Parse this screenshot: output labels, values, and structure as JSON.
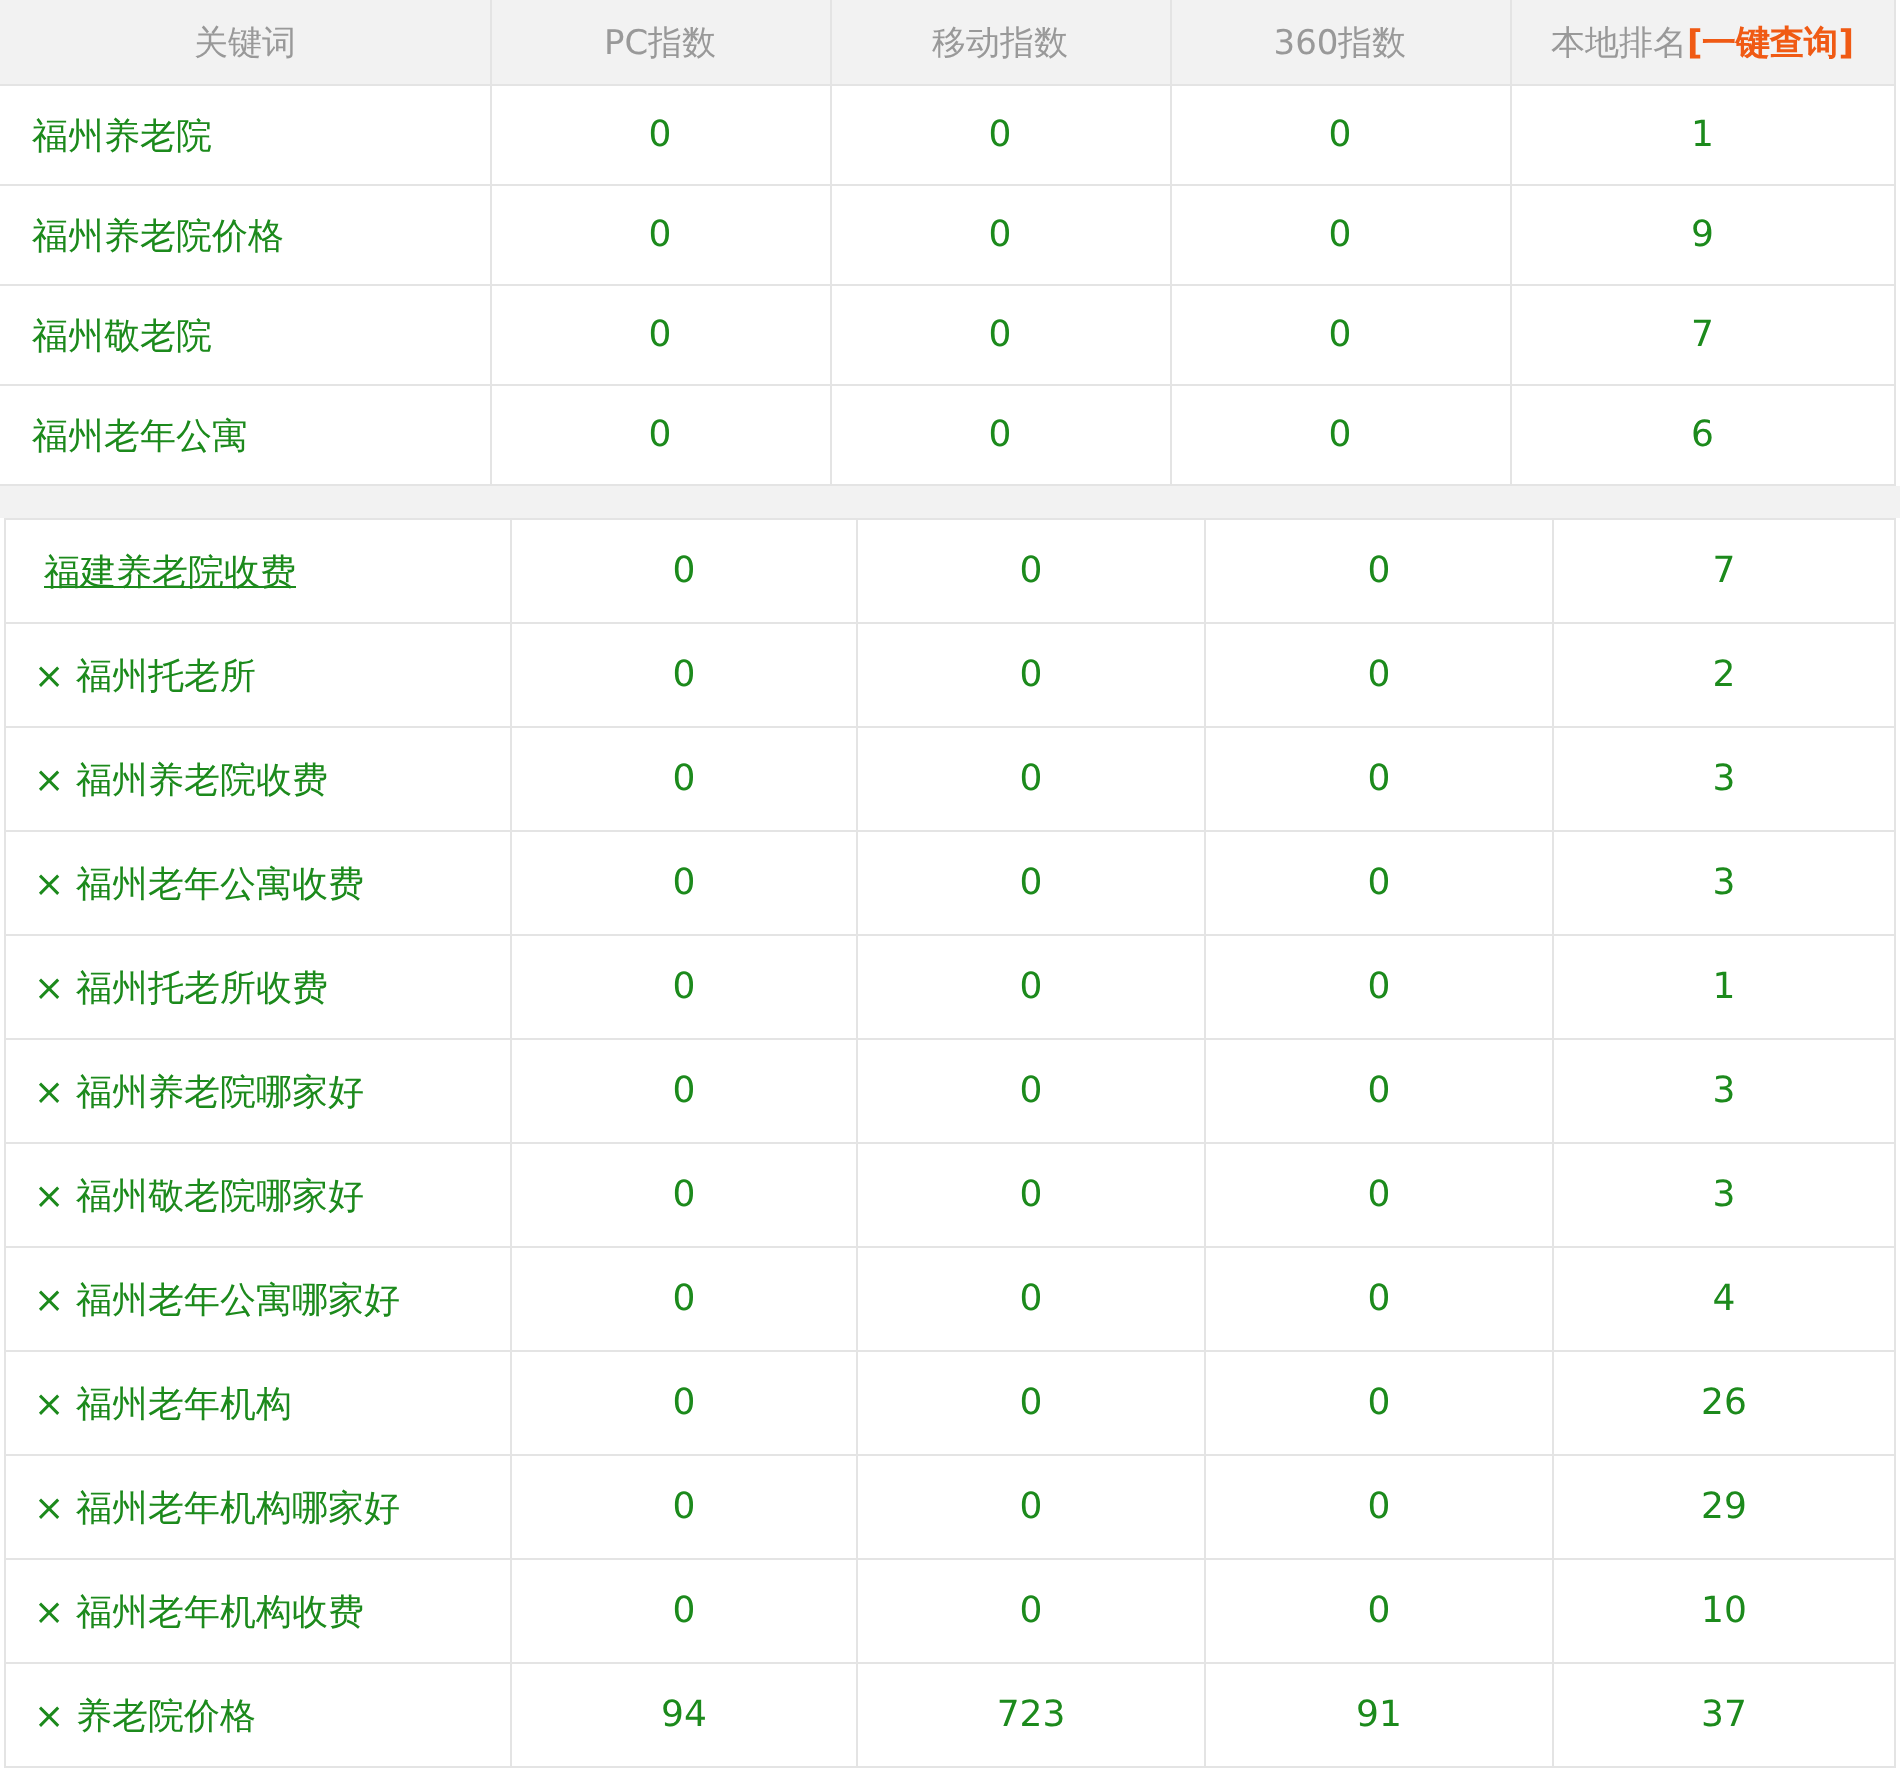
{
  "table": {
    "columns": [
      {
        "label": "关键词"
      },
      {
        "label": "PC指数"
      },
      {
        "label": "移动指数"
      },
      {
        "label": "360指数"
      },
      {
        "label": "本地排名",
        "link": "[一键查询]"
      }
    ],
    "rows": [
      {
        "keyword": "福州养老院",
        "pc": "0",
        "mobile": "0",
        "s360": "0",
        "rank": "1"
      },
      {
        "keyword": "福州养老院价格",
        "pc": "0",
        "mobile": "0",
        "s360": "0",
        "rank": "9"
      },
      {
        "keyword": "福州敬老院",
        "pc": "0",
        "mobile": "0",
        "s360": "0",
        "rank": "7"
      },
      {
        "keyword": "福州老年公寓",
        "pc": "0",
        "mobile": "0",
        "s360": "0",
        "rank": "6"
      }
    ]
  },
  "related_table": {
    "rows": [
      {
        "keyword": "福建养老院收费",
        "underlined": true,
        "pc": "0",
        "mobile": "0",
        "s360": "0",
        "rank": "7"
      },
      {
        "remove": "×",
        "keyword": "福州托老所",
        "underlined": false,
        "pc": "0",
        "mobile": "0",
        "s360": "0",
        "rank": "2"
      },
      {
        "remove": "×",
        "keyword": "福州养老院收费",
        "underlined": false,
        "pc": "0",
        "mobile": "0",
        "s360": "0",
        "rank": "3"
      },
      {
        "remove": "×",
        "keyword": "福州老年公寓收费",
        "underlined": false,
        "pc": "0",
        "mobile": "0",
        "s360": "0",
        "rank": "3"
      },
      {
        "remove": "×",
        "keyword": "福州托老所收费",
        "underlined": false,
        "pc": "0",
        "mobile": "0",
        "s360": "0",
        "rank": "1"
      },
      {
        "remove": "×",
        "keyword": "福州养老院哪家好",
        "underlined": false,
        "pc": "0",
        "mobile": "0",
        "s360": "0",
        "rank": "3"
      },
      {
        "remove": "×",
        "keyword": "福州敬老院哪家好",
        "underlined": false,
        "pc": "0",
        "mobile": "0",
        "s360": "0",
        "rank": "3"
      },
      {
        "remove": "×",
        "keyword": "福州老年公寓哪家好",
        "underlined": false,
        "pc": "0",
        "mobile": "0",
        "s360": "0",
        "rank": "4"
      },
      {
        "remove": "×",
        "keyword": "福州老年机构",
        "underlined": false,
        "pc": "0",
        "mobile": "0",
        "s360": "0",
        "rank": "26"
      },
      {
        "remove": "×",
        "keyword": "福州老年机构哪家好",
        "underlined": false,
        "pc": "0",
        "mobile": "0",
        "s360": "0",
        "rank": "29"
      },
      {
        "remove": "×",
        "keyword": "福州老年机构收费",
        "underlined": false,
        "pc": "0",
        "mobile": "0",
        "s360": "0",
        "rank": "10"
      },
      {
        "remove": "×",
        "keyword": "养老院价格",
        "underlined": false,
        "pc": "94",
        "mobile": "723",
        "s360": "91",
        "rank": "37"
      }
    ]
  }
}
